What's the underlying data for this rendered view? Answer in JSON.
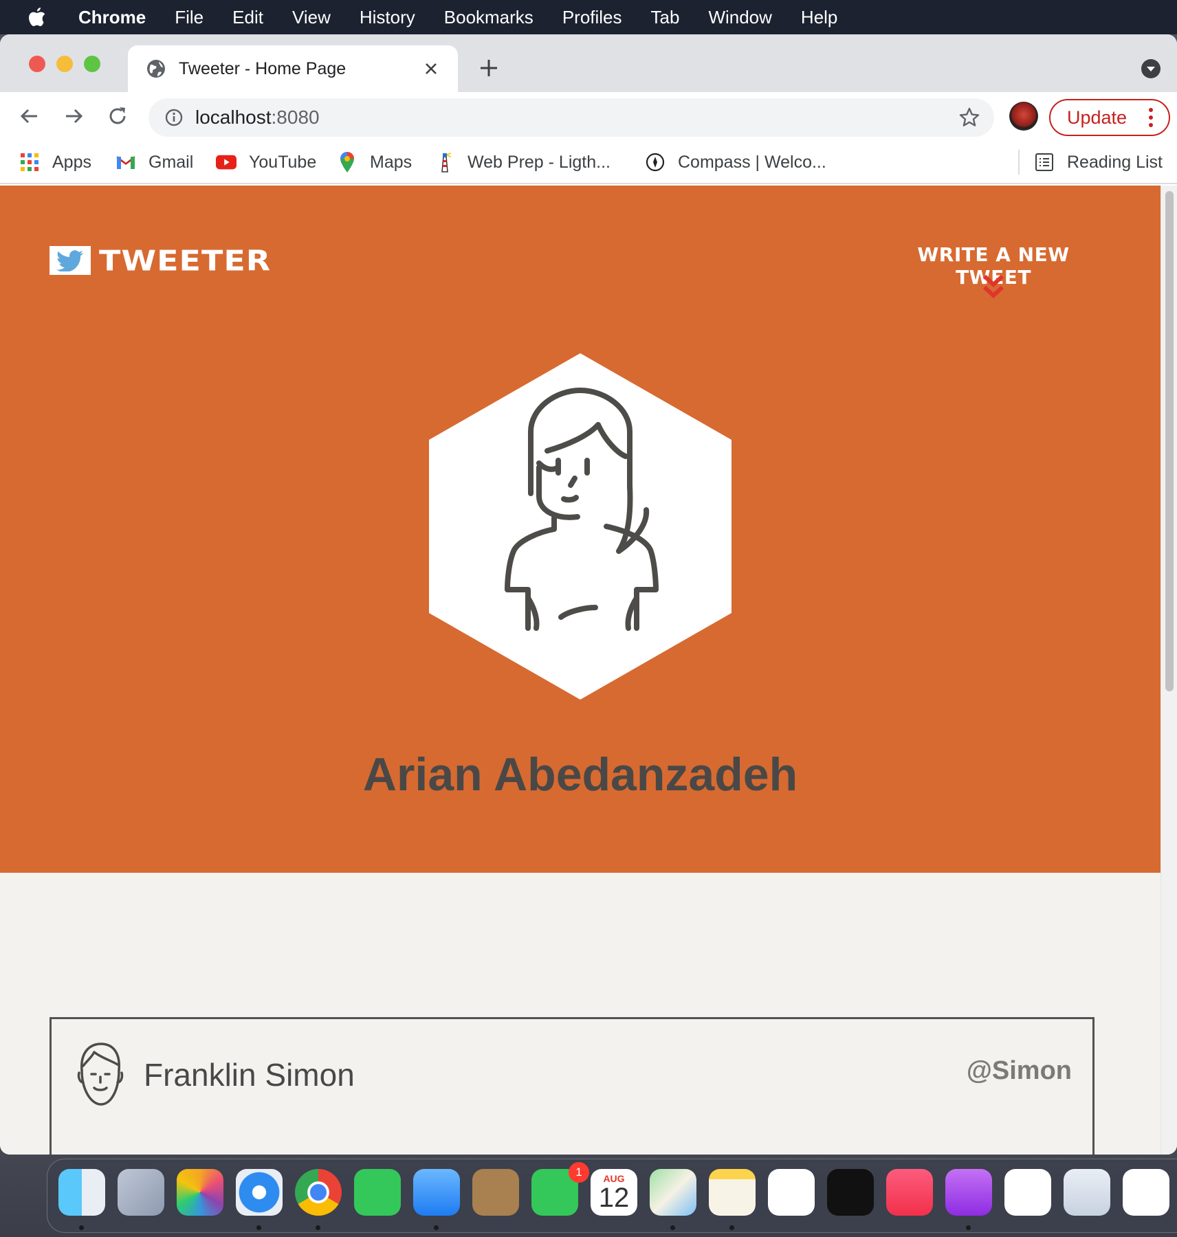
{
  "menubar": {
    "app": "Chrome",
    "items": [
      "File",
      "Edit",
      "View",
      "History",
      "Bookmarks",
      "Profiles",
      "Tab",
      "Window",
      "Help"
    ]
  },
  "browser": {
    "tab_title": "Tweeter - Home Page",
    "url_host": "localhost",
    "url_port": ":8080",
    "update_label": "Update",
    "bookmarks": [
      {
        "label": "Apps",
        "icon": "apps-grid-icon"
      },
      {
        "label": "Gmail",
        "icon": "gmail-icon"
      },
      {
        "label": "YouTube",
        "icon": "youtube-icon"
      },
      {
        "label": "Maps",
        "icon": "maps-pin-icon"
      },
      {
        "label": "Web Prep - Ligth...",
        "icon": "lighthouse-icon"
      },
      {
        "label": "Compass | Welco...",
        "icon": "compass-icon"
      }
    ],
    "reading_list": "Reading List"
  },
  "page": {
    "brand": "TWEETER",
    "compose_label": "WRITE A NEW TWEET",
    "profile_name": "Arian Abedanzadeh",
    "tweet": {
      "name": "Franklin Simon",
      "handle": "@Simon"
    }
  },
  "dock": {
    "apps": [
      "Finder",
      "Launchpad",
      "Photos",
      "Safari",
      "Chrome",
      "Messages",
      "Mail",
      "Contacts",
      "FaceTime",
      "Calendar",
      "Maps",
      "Notes",
      "Reminders",
      "TV",
      "Music",
      "Podcasts",
      "News",
      "Keynote",
      "Numbers"
    ],
    "facetime_badge": "1",
    "calendar_month": "AUG",
    "calendar_day": "12"
  },
  "colors": {
    "hero": "#d76a31",
    "page_bg": "#f4f2ef",
    "text_dark": "#4a4846",
    "accent_red": "#e0352b",
    "update_red": "#c5221f"
  }
}
